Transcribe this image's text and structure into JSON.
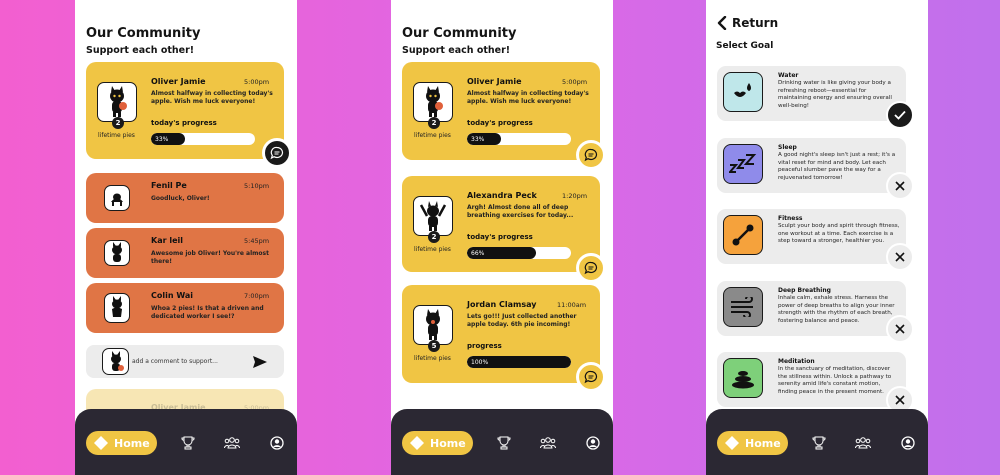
{
  "community": {
    "title": "Our Community",
    "subtitle": "Support each other!",
    "lifetime_label": "lifetime pies",
    "progress_label": "today's progress",
    "progress_label_alt": "progress"
  },
  "screen1": {
    "main_post": {
      "name": "Oliver Jamie",
      "time": "5:00pm",
      "message": "Almost halfway in collecting today's apple. Wish me luck everyone!",
      "pies": "2",
      "progress_text": "33%",
      "progress": 0.33
    },
    "comments": [
      {
        "name": "Fenil Pe",
        "time": "5:10pm",
        "message": "Goodluck, Oliver!"
      },
      {
        "name": "Kar leil",
        "time": "5:45pm",
        "message": "Awesome job Oliver! You're almost there!"
      },
      {
        "name": "Colin Wai",
        "time": "7:00pm",
        "message": "Whoa 2 pies! Is that a driven and dedicated worker I see!?"
      }
    ],
    "comment_placeholder": "add a comment to support...",
    "faded_post": {
      "name": "Oliver Jamie",
      "time": "5:00pm"
    }
  },
  "screen2": {
    "posts": [
      {
        "name": "Oliver Jamie",
        "time": "5:00pm",
        "message": "Almost halfway in collecting today's apple. Wish me luck everyone!",
        "pies": "2",
        "progress_text": "33%",
        "progress": 0.33,
        "progress_label": "today's progress"
      },
      {
        "name": "Alexandra Peck",
        "time": "1:20pm",
        "message": "Argh! Almost done all of deep breathing exercises for today...",
        "pies": "2",
        "progress_text": "66%",
        "progress": 0.66,
        "progress_label": "today's progress"
      },
      {
        "name": "Jordan Clamsay",
        "time": "11:00am",
        "message": "Lets go!!! Just collected another apple today. 6th pie incoming!",
        "pies": "5",
        "progress_text": "100%",
        "progress": 1.0,
        "progress_label": "progress"
      }
    ]
  },
  "goals": {
    "return_label": "Return",
    "title": "Select Goal",
    "items": [
      {
        "name": "Water",
        "description": "Drinking water is like giving your body a refreshing reboot—essential for maintaining energy and ensuring overall well-being!",
        "selected": true,
        "color": "#bfe7ea",
        "icon": "water-drops-icon"
      },
      {
        "name": "Sleep",
        "description": "A good night's sleep isn't just a rest; it's a vital reset for mind and body. Let each peaceful slumber pave the way for a rejuvenated tomorrow!",
        "selected": false,
        "color": "#8f8bea",
        "icon": "zzz-sleep-icon"
      },
      {
        "name": "Fitness",
        "description": "Sculpt your body and spirit through fitness, one workout at a time. Each exercise is a step toward a stronger, healthier you.",
        "selected": false,
        "color": "#f5a23c",
        "icon": "dumbbell-icon"
      },
      {
        "name": "Deep Breathing",
        "description": "Inhale calm, exhale stress. Harness the power of deep breaths to align your inner strength with the rhythm of each breath, fostering balance and peace.",
        "selected": false,
        "color": "#8a8a8a",
        "icon": "wind-icon"
      },
      {
        "name": "Meditation",
        "description": "In the sanctuary of meditation, discover the stillness within. Unlock a pathway to serenity amid life's constant motion, finding peace in the present moment.",
        "selected": false,
        "color": "#7ed07a",
        "icon": "stacked-stones-icon"
      }
    ]
  },
  "nav": {
    "home_label": "Home",
    "icons": [
      "home-diamond-icon",
      "trophy-icon",
      "community-icon",
      "profile-icon"
    ]
  },
  "colors": {
    "card_yellow": "#f0c544",
    "card_orange": "#e07545",
    "nav_dark": "#2b2833",
    "background_gradient": [
      "#f35fd0",
      "#c070ec"
    ]
  }
}
